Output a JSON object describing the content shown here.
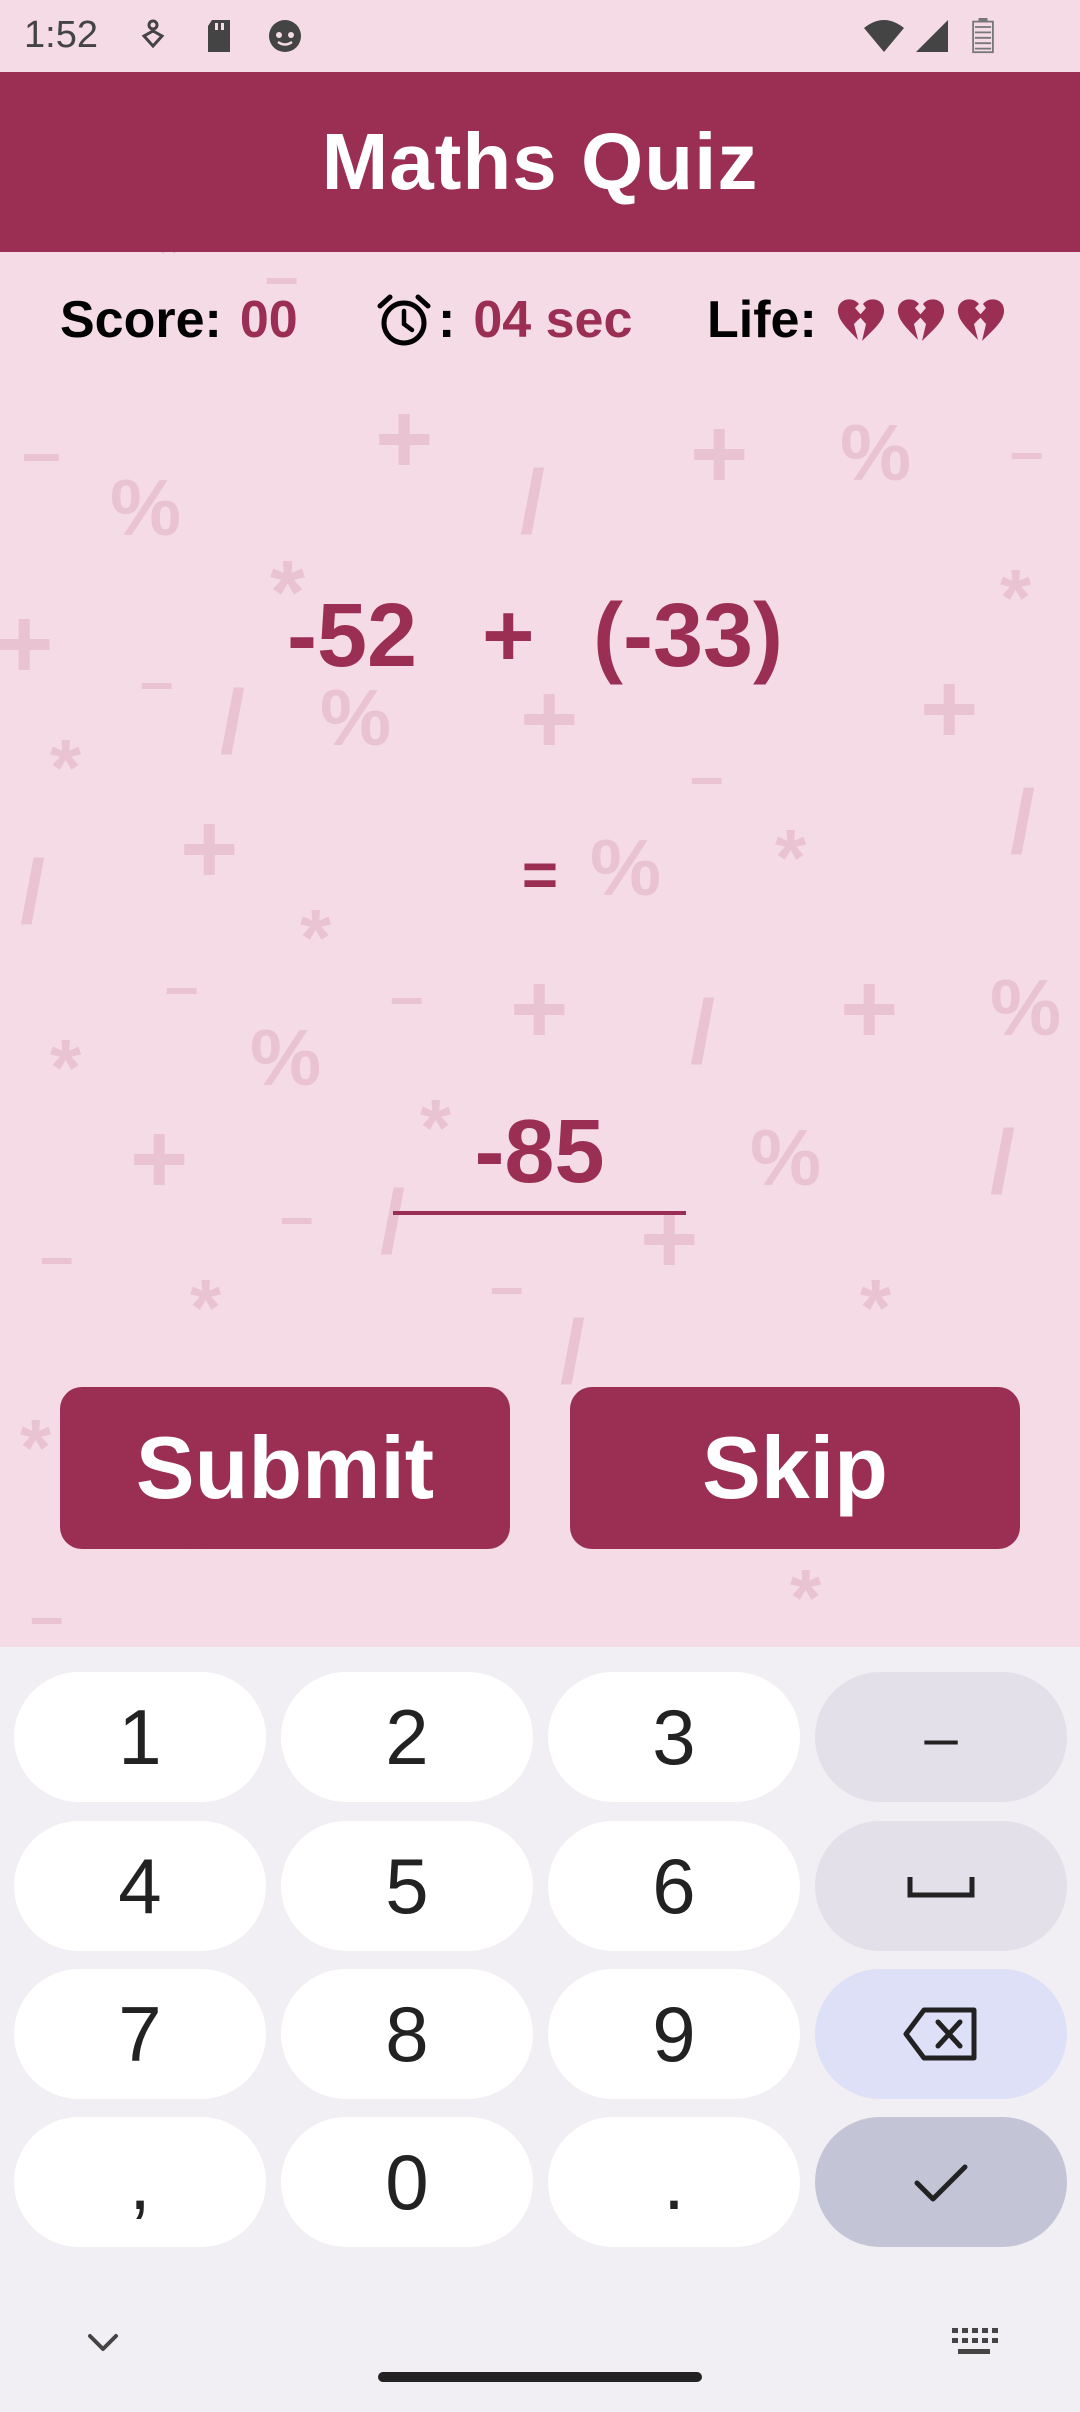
{
  "status_bar": {
    "time": "1:52"
  },
  "app_bar": {
    "title": "Maths Quiz"
  },
  "info": {
    "score_label": "Score:",
    "score_value": "00",
    "timer_separator": ":",
    "timer_value": "04 sec",
    "life_label": "Life:",
    "lives_remaining": 3
  },
  "question": {
    "operand1": "-52",
    "operator": "+",
    "operand2": "(-33)",
    "equals": "="
  },
  "answer": {
    "value": "-85"
  },
  "buttons": {
    "submit": "Submit",
    "skip": "Skip"
  },
  "keyboard": {
    "k1": "1",
    "k2": "2",
    "k3": "3",
    "minus": "–",
    "k4": "4",
    "k5": "5",
    "k6": "6",
    "k7": "7",
    "k8": "8",
    "k9": "9",
    "comma": ",",
    "k0": "0",
    "period": "."
  },
  "colors": {
    "accent": "#9b2f53",
    "background": "#f5dbe5",
    "heart": "#9b2f53"
  }
}
